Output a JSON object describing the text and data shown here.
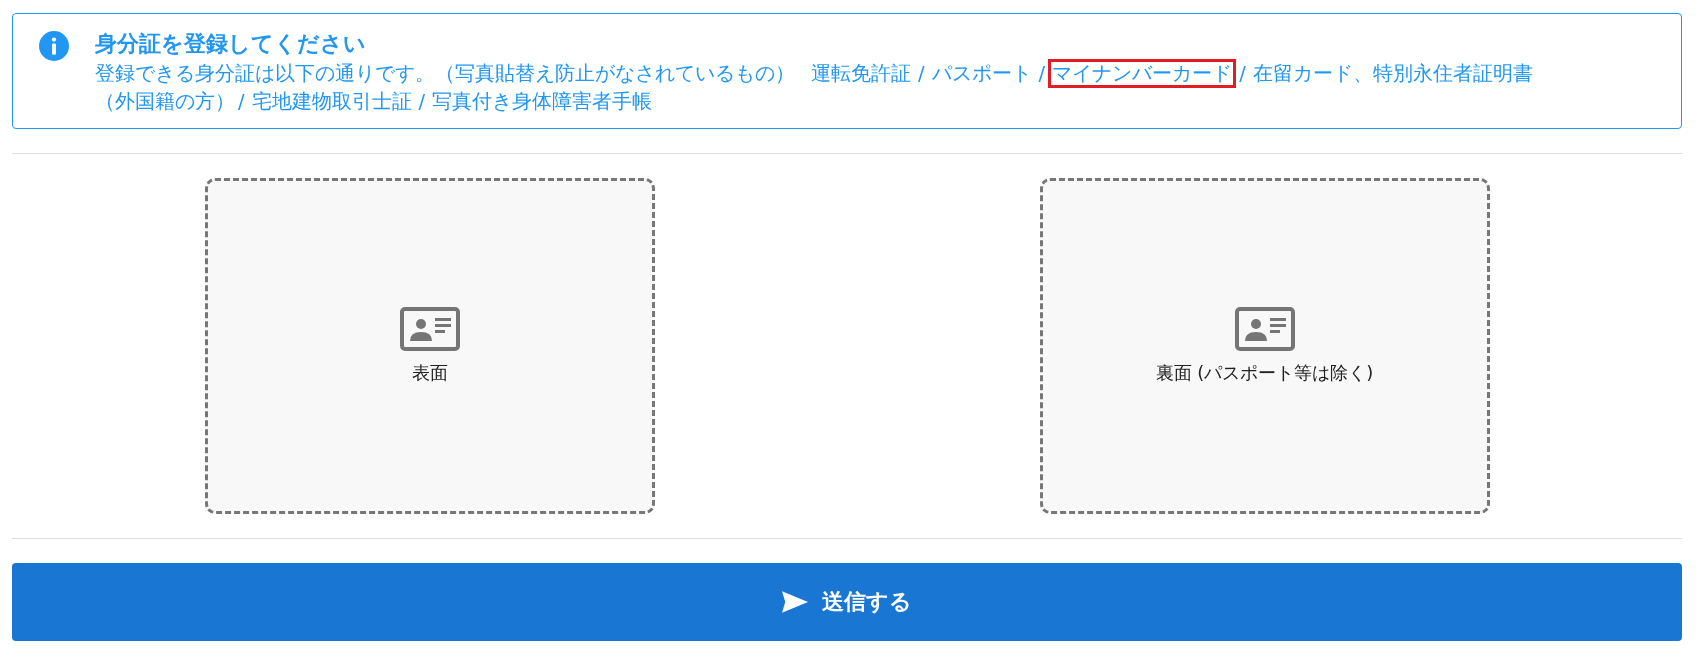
{
  "notice": {
    "title": "身分証を登録してください",
    "intro": "登録できる身分証は以下の通りです。（写真貼替え防止がなされているもの）",
    "separator": "/",
    "id_types": [
      {
        "label": "運転免許証",
        "highlighted": false
      },
      {
        "label": "パスポート",
        "highlighted": false
      },
      {
        "label": "マイナンバーカード",
        "highlighted": true
      },
      {
        "label": "在留カード、特別永住者証明書",
        "note": "（外国籍の方）",
        "highlighted": false
      },
      {
        "label": "宅地建物取引士証",
        "highlighted": false
      },
      {
        "label": "写真付き身体障害者手帳",
        "highlighted": false
      }
    ]
  },
  "uploads": [
    {
      "label": "表面"
    },
    {
      "label": "裏面 (パスポート等は除く)"
    }
  ],
  "submit_button": {
    "label": "送信する"
  }
}
